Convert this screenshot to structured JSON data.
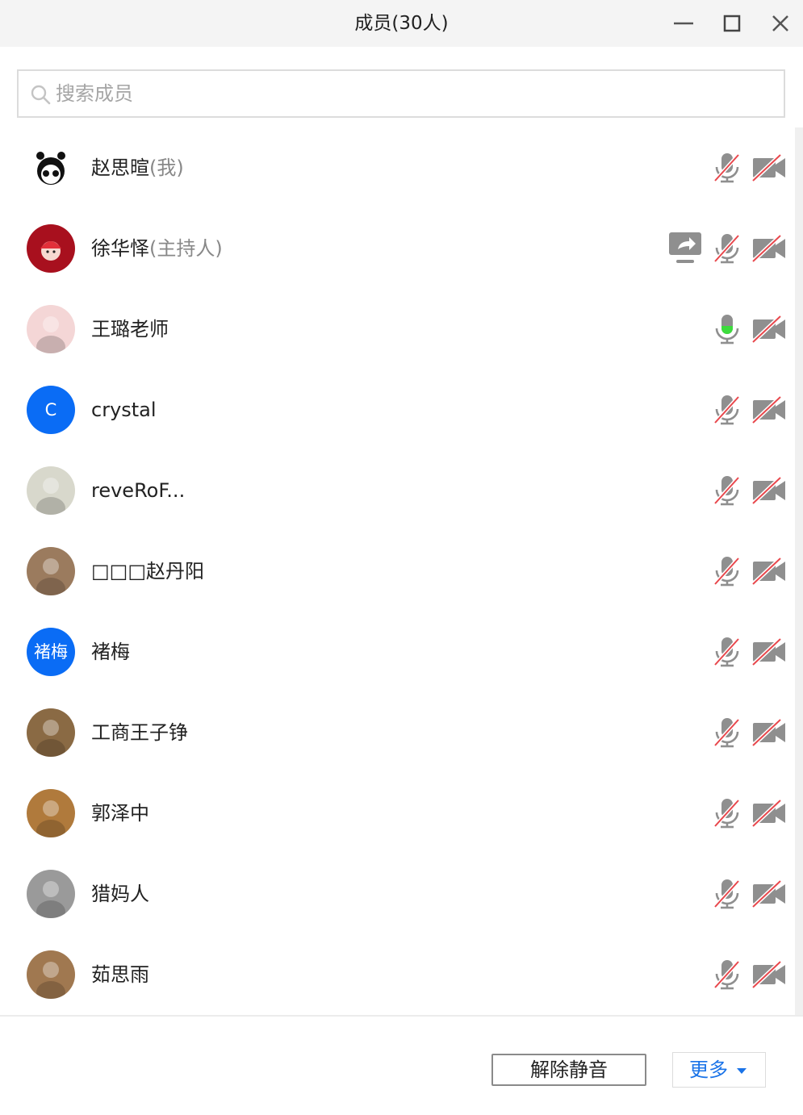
{
  "window": {
    "title": "成员(30人)"
  },
  "search": {
    "placeholder": "搜索成员"
  },
  "members": [
    {
      "name": "赵思暄",
      "role": "(我)",
      "avatar_text": "",
      "avatar_color": "#ffffff",
      "avatar_desc": "cartoon-girl-avatar",
      "mic": "muted",
      "camera": "off",
      "sharing": false
    },
    {
      "name": "徐华怿",
      "role": "(主持人)",
      "avatar_text": "",
      "avatar_color": "#a8101e",
      "avatar_desc": "red-cartoon-avatar",
      "mic": "muted",
      "camera": "off",
      "sharing": true
    },
    {
      "name": "王璐老师",
      "role": "",
      "avatar_text": "",
      "avatar_color": "#f4d6d6",
      "avatar_desc": "child-photo-avatar",
      "mic": "speaking",
      "camera": "off",
      "sharing": false
    },
    {
      "name": "crystal",
      "role": "",
      "avatar_text": "C",
      "avatar_color": "#0a6cf5",
      "avatar_desc": "",
      "mic": "muted",
      "camera": "off",
      "sharing": false
    },
    {
      "name": "reveRoF...",
      "role": "",
      "avatar_text": "",
      "avatar_color": "#d8d8cc",
      "avatar_desc": "outdoor-photo-avatar",
      "mic": "muted",
      "camera": "off",
      "sharing": false
    },
    {
      "name": "□□□赵丹阳",
      "role": "",
      "avatar_text": "",
      "avatar_color": "#9b7b5e",
      "avatar_desc": "brown-photo-avatar",
      "mic": "muted",
      "camera": "off",
      "sharing": false
    },
    {
      "name": "褚梅",
      "role": "",
      "avatar_text": "褚梅",
      "avatar_color": "#0a6cf5",
      "avatar_desc": "",
      "mic": "muted",
      "camera": "off",
      "sharing": false
    },
    {
      "name": "工商王子铮",
      "role": "",
      "avatar_text": "",
      "avatar_color": "#8a6a44",
      "avatar_desc": "tiger-cub-photo-avatar",
      "mic": "muted",
      "camera": "off",
      "sharing": false
    },
    {
      "name": "郭泽中",
      "role": "",
      "avatar_text": "",
      "avatar_color": "#b07a3c",
      "avatar_desc": "sunset-photo-avatar",
      "mic": "muted",
      "camera": "off",
      "sharing": false
    },
    {
      "name": "猎妈人",
      "role": "",
      "avatar_text": "",
      "avatar_color": "#9a9a9a",
      "avatar_desc": "cat-photo-avatar",
      "mic": "muted",
      "camera": "off",
      "sharing": false
    },
    {
      "name": "茹思雨",
      "role": "",
      "avatar_text": "",
      "avatar_color": "#a07850",
      "avatar_desc": "child-photo-avatar",
      "mic": "muted",
      "camera": "off",
      "sharing": false
    }
  ],
  "footer": {
    "unmute_label": "解除静音",
    "more_label": "更多"
  },
  "colors": {
    "accent": "#1a73e8",
    "muted_slash": "#e8474c",
    "icon_gray": "#8f8f8f",
    "speaking_green": "#3ddc3d"
  }
}
